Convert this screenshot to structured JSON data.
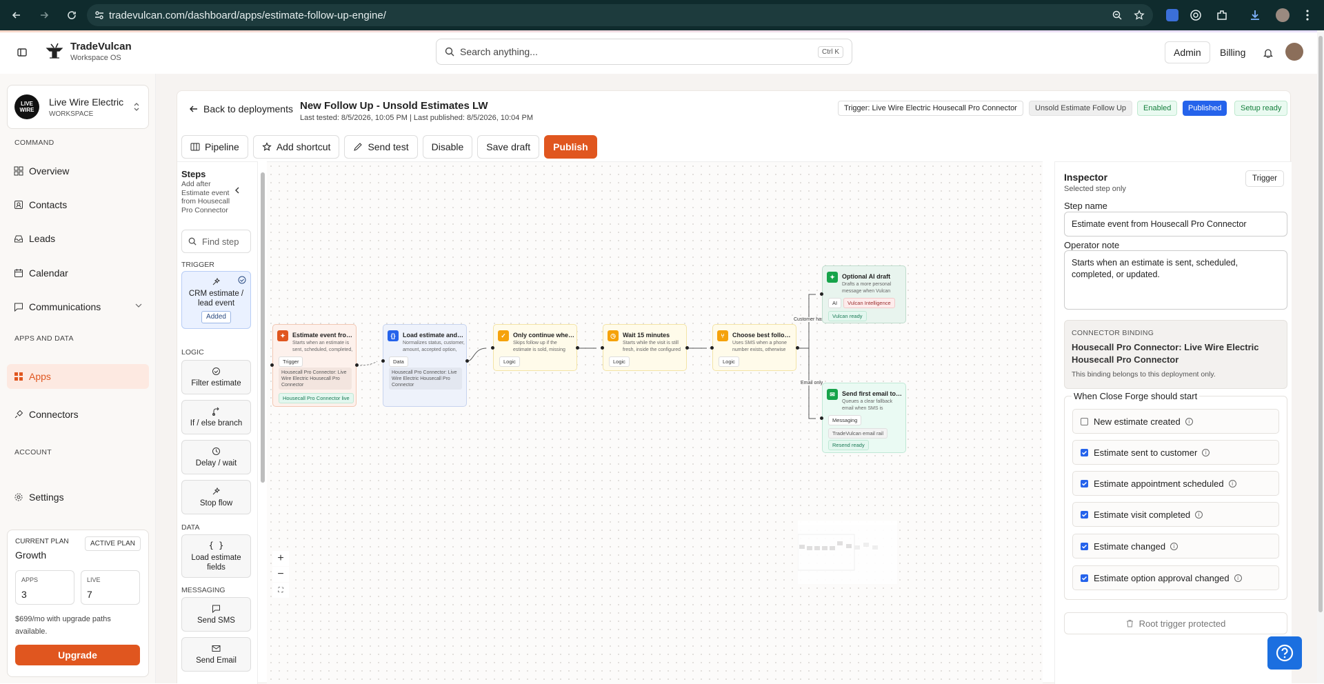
{
  "browser": {
    "url": "tradevulcan.com/dashboard/apps/estimate-follow-up-engine/"
  },
  "brand": {
    "name": "TradeVulcan",
    "sub": "Workspace OS"
  },
  "search": {
    "placeholder": "Search anything...",
    "shortcut": "Ctrl K"
  },
  "header": {
    "admin": "Admin",
    "billing": "Billing"
  },
  "workspace": {
    "name": "Live Wire Electric",
    "type": "WORKSPACE",
    "logo_top": "LIVE",
    "logo_bottom": "WIRE"
  },
  "sidebar": {
    "command_label": "COMMAND",
    "apps_label": "APPS AND DATA",
    "account_label": "ACCOUNT",
    "items": {
      "overview": "Overview",
      "contacts": "Contacts",
      "leads": "Leads",
      "calendar": "Calendar",
      "communications": "Communications",
      "apps": "Apps",
      "connectors": "Connectors",
      "settings": "Settings"
    }
  },
  "plan": {
    "current_label": "CURRENT PLAN",
    "name": "Growth",
    "active_label": "ACTIVE PLAN",
    "apps_label": "APPS",
    "apps_value": "3",
    "live_label": "LIVE",
    "live_value": "7",
    "price_text": "$699/mo with upgrade paths available.",
    "upgrade": "Upgrade"
  },
  "deployment": {
    "back": "Back to deployments",
    "title": "New Follow Up - Unsold Estimates LW",
    "meta": "Last tested: 8/5/2026, 10:05 PM | Last published: 8/5/2026, 10:04 PM",
    "pills": {
      "trigger": "Trigger: Live Wire Electric Housecall Pro Connector",
      "template": "Unsold Estimate Follow Up",
      "enabled": "Enabled",
      "published": "Published",
      "setup": "Setup ready"
    }
  },
  "toolbar": {
    "pipeline": "Pipeline",
    "shortcut": "Add shortcut",
    "send_test": "Send test",
    "disable": "Disable",
    "save_draft": "Save draft",
    "publish": "Publish"
  },
  "steps": {
    "heading": "Steps",
    "desc": "Add after Estimate event from Housecall Pro Connector",
    "find_placeholder": "Find step",
    "trigger_label": "TRIGGER",
    "logic_label": "LOGIC",
    "data_label": "DATA",
    "messaging_label": "MESSAGING",
    "crm": "CRM estimate / lead event",
    "added": "Added",
    "filter": "Filter estimate",
    "ifelse": "If / else branch",
    "delay": "Delay / wait",
    "stop": "Stop flow",
    "load": "Load estimate fields",
    "sms": "Send SMS",
    "email": "Send Email"
  },
  "nodes": {
    "n1": {
      "title": "Estimate event from Housecall Pro Connector",
      "desc": "Starts when an estimate is sent, scheduled, completed, or updated.",
      "tag": "Trigger",
      "binding": "Housecall Pro Connector: Live Wire Electric Housecall Pro Connector",
      "live": "Housecall Pro Connector live"
    },
    "n2": {
      "title": "Load estimate and customer",
      "desc": "Normalizes status, customer, amount, accepted option, and more.",
      "tag": "Data",
      "binding": "Housecall Pro Connector: Live Wire Electric Housecall Pro Connector"
    },
    "n3": {
      "title": "Only continue when follow-up is needed",
      "desc": "Skips follow up if the estimate is sold, missing contact info.",
      "tag": "Logic"
    },
    "n4": {
      "title": "Wait 15 minutes",
      "desc": "Starts while the visit is still fresh, inside the configured window.",
      "tag": "Logic"
    },
    "n5": {
      "title": "Choose best follow-up channel",
      "desc": "Uses SMS when a phone number exists, otherwise falls back to email.",
      "tag": "Logic"
    },
    "n6": {
      "title": "Optional AI draft",
      "desc": "Drafts a more personal message when Vulcan Intelligence is enabled.",
      "tag": "AI",
      "tag2": "Vulcan Intelligence",
      "status": "Vulcan ready"
    },
    "n7": {
      "title": "Send first email touch",
      "desc": "Queues a clear fallback email when SMS is unavailable.",
      "tag": "Messaging",
      "tag2": "TradeVulcan email rail",
      "status": "Resend ready"
    }
  },
  "edges": {
    "sms": "Customer has SMS",
    "email": "Email only"
  },
  "zoom": {
    "in": "+",
    "out": "−"
  },
  "inspector": {
    "heading": "Inspector",
    "sub": "Selected step only",
    "trigger_btn": "Trigger",
    "step_name_label": "Step name",
    "step_name": "Estimate event from Housecall Pro Connector",
    "note_label": "Operator note",
    "note": "Starts when an estimate is sent, scheduled, completed, or updated.",
    "binding_label": "CONNECTOR BINDING",
    "binding_title": "Housecall Pro Connector: Live Wire Electric Housecall Pro Connector",
    "binding_desc": "This binding belongs to this deployment only.",
    "start_label": "When Close Forge should start",
    "options": [
      {
        "label": "New estimate created",
        "checked": false
      },
      {
        "label": "Estimate sent to customer",
        "checked": true
      },
      {
        "label": "Estimate appointment scheduled",
        "checked": true
      },
      {
        "label": "Estimate visit completed",
        "checked": true
      },
      {
        "label": "Estimate changed",
        "checked": true
      },
      {
        "label": "Estimate option approval changed",
        "checked": true
      }
    ],
    "root": "Root trigger protected"
  },
  "icons": [
    "back-icon",
    "forward-icon",
    "reload-icon",
    "site-info-icon",
    "zoom-icon",
    "star-icon",
    "extension-icon",
    "download-icon",
    "profile-icon",
    "menu-icon",
    "sidebar-toggle-icon",
    "search-icon",
    "bell-icon",
    "chevron-icon",
    "pipeline-icon",
    "shortcut-icon",
    "send-icon",
    "trash-icon",
    "help-icon"
  ],
  "colors": {
    "accent": "#e0561f",
    "published": "#2563eb",
    "enabled": "#16a34a",
    "browser": "#0f2b2d"
  }
}
